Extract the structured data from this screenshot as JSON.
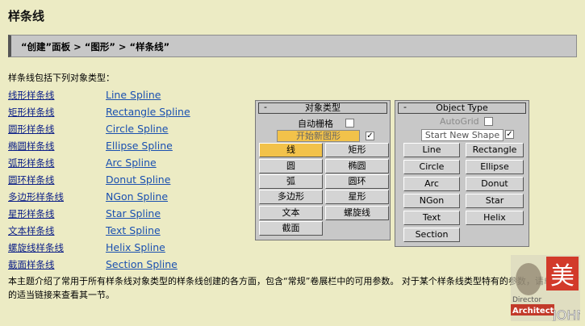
{
  "page": {
    "title": "样条线",
    "breadcrumb": "“创建”面板 > “图形” > “样条线”",
    "intro": "样条线包括下列对象类型：",
    "footer": "本主题介绍了常用于所有样条线对象类型的样条线创建的各方面，包含“常规”卷展栏中的可用参数。 对于某个样条线类型特有的参数，请单击上面的适当链接来查看其一节。"
  },
  "splines": [
    {
      "cn": "线形样条线",
      "en": "Line Spline"
    },
    {
      "cn": "矩形样条线",
      "en": "Rectangle Spline"
    },
    {
      "cn": "圆形样条线",
      "en": "Circle Spline"
    },
    {
      "cn": "椭圆样条线",
      "en": "Ellipse Spline"
    },
    {
      "cn": "弧形样条线",
      "en": "Arc Spline"
    },
    {
      "cn": "圆环样条线",
      "en": "Donut Spline"
    },
    {
      "cn": "多边形样条线",
      "en": "NGon Spline"
    },
    {
      "cn": "星形样条线",
      "en": "Star Spline"
    },
    {
      "cn": "文本样条线",
      "en": "Text Spline"
    },
    {
      "cn": "螺旋线样条线",
      "en": "Helix Spline"
    },
    {
      "cn": "截面样条线",
      "en": "Section Spline"
    }
  ],
  "panel_cn": {
    "minus": "-",
    "title": "对象类型",
    "autogrid": "自动栅格",
    "start_new_shape": "开始新图形",
    "start_checked": "✓",
    "buttons": [
      "线",
      "矩形",
      "圆",
      "椭圆",
      "弧",
      "圆环",
      "多边形",
      "星形",
      "文本",
      "螺旋线",
      "截面"
    ]
  },
  "panel_en": {
    "minus": "-",
    "title": "Object Type",
    "autogrid": "AutoGrid",
    "start_new_shape": "Start New Shape",
    "start_checked": "✓",
    "buttons": [
      "Line",
      "Rectangle",
      "Circle",
      "Ellipse",
      "Arc",
      "Donut",
      "NGon",
      "Star",
      "Text",
      "Helix",
      "Section"
    ]
  },
  "logo": {
    "big_char": "美",
    "line1": "Director",
    "line2": "Architect",
    "line3": "JOHN"
  },
  "colors": {
    "background": "#ecebc4",
    "link": "#1a50b0",
    "active_button": "#f2c24a",
    "panel": "#c8c8c8"
  }
}
